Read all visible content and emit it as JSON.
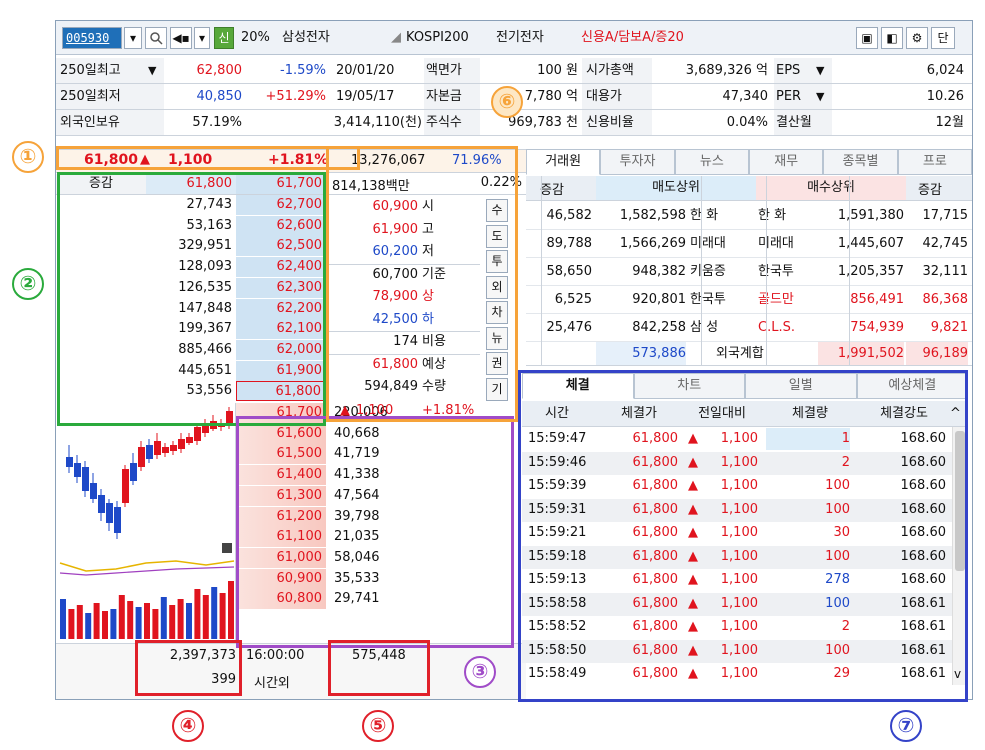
{
  "toolbar": {
    "code": "005930",
    "credit_badge": "신",
    "margin": "20%",
    "stock_name": "삼성전자",
    "index": "KOSPI200",
    "sector": "전기전자",
    "credit_info": "신용A/담보A/증20",
    "menu_label": "단"
  },
  "info": {
    "rows": [
      {
        "l1": "250일최고",
        "v1": "62,800",
        "p1": "-1.59%",
        "d1": "20/01/20",
        "l2": "액면가",
        "v2": "100 원",
        "l3": "시가총액",
        "v3": "3,689,326 억",
        "l4": "EPS",
        "v4": "6,024"
      },
      {
        "l1": "250일최저",
        "v1": "40,850",
        "p1": "+51.29%",
        "d1": "19/05/17",
        "l2": "자본금",
        "v2": "7,780 억",
        "l3": "대용가",
        "v3": "47,340",
        "l4": "PER",
        "v4": "10.26"
      },
      {
        "l1": "외국인보유",
        "v1": "57.19%",
        "p1": "3,414,110(천)",
        "d1": "",
        "l2": "주식수",
        "v2": "969,783 천",
        "l3": "신용비율",
        "v3": "0.04%",
        "l4": "결산월",
        "v4": "12월"
      }
    ]
  },
  "price_bar": {
    "price": "61,800",
    "change": "1,100",
    "rate": "+1.81%",
    "volume": "13,276,067",
    "ratio": "71.96%"
  },
  "orderbook": {
    "header_label": "증감",
    "header_price": "61,800",
    "header_ask": "61,700",
    "trade_value": "814,138백만",
    "trade_rate": "0.22%",
    "asks": [
      {
        "qty": "27,743",
        "price": "62,700"
      },
      {
        "qty": "53,163",
        "price": "62,600"
      },
      {
        "qty": "329,951",
        "price": "62,500"
      },
      {
        "qty": "128,093",
        "price": "62,400"
      },
      {
        "qty": "126,535",
        "price": "62,300"
      },
      {
        "qty": "147,848",
        "price": "62,200"
      },
      {
        "qty": "199,367",
        "price": "62,100"
      },
      {
        "qty": "885,466",
        "price": "62,000"
      },
      {
        "qty": "445,651",
        "price": "61,900"
      },
      {
        "qty": "53,556",
        "price": "61,800"
      }
    ],
    "bids": [
      {
        "price": "61,700",
        "qty": "220,006"
      },
      {
        "price": "61,600",
        "qty": "40,668"
      },
      {
        "price": "61,500",
        "qty": "41,719"
      },
      {
        "price": "61,400",
        "qty": "41,338"
      },
      {
        "price": "61,300",
        "qty": "47,564"
      },
      {
        "price": "61,200",
        "qty": "39,798"
      },
      {
        "price": "61,100",
        "qty": "21,035"
      },
      {
        "price": "61,000",
        "qty": "58,046"
      },
      {
        "price": "60,900",
        "qty": "35,533"
      },
      {
        "price": "60,800",
        "qty": "29,741"
      }
    ],
    "summary": [
      {
        "v": "60,900",
        "l": "시"
      },
      {
        "v": "61,900",
        "l": "고"
      },
      {
        "v": "60,200",
        "l": "저"
      },
      {
        "v": "60,700",
        "l": "기준"
      },
      {
        "v": "78,900",
        "l": "상"
      },
      {
        "v": "42,500",
        "l": "하"
      },
      {
        "v": "174",
        "l": "비용"
      },
      {
        "v": "61,800",
        "l": "예상"
      },
      {
        "v": "594,849",
        "l": "수량"
      }
    ],
    "expected_change": "1,100",
    "expected_rate": "+1.81%",
    "side_buttons": [
      "수",
      "도",
      "투",
      "외",
      "차",
      "뉴",
      "권",
      "기"
    ],
    "total_ask": "2,397,373",
    "total_ask_diff": "399",
    "time": "16:00:00",
    "time_label": "시간외",
    "total_bid": "575,448"
  },
  "broker": {
    "tabs": [
      "거래원",
      "투자자",
      "뉴스",
      "재무",
      "종목별",
      "프로"
    ],
    "head": {
      "c1": "증감",
      "c2": "매도상위",
      "c3": "매수상위",
      "c4": "증감"
    },
    "rows": [
      {
        "sdiff": "46,582",
        "sqty": "1,582,598",
        "sname": "한 화",
        "bname": "한 화",
        "bqty": "1,591,380",
        "bdiff": "17,715"
      },
      {
        "sdiff": "89,788",
        "sqty": "1,566,269",
        "sname": "미래대",
        "bname": "미래대",
        "bqty": "1,445,607",
        "bdiff": "42,745"
      },
      {
        "sdiff": "58,650",
        "sqty": "948,382",
        "sname": "키움증",
        "bname": "한국투",
        "bqty": "1,205,357",
        "bdiff": "32,111"
      },
      {
        "sdiff": "6,525",
        "sqty": "920,801",
        "sname": "한국투",
        "bname": "골드만",
        "bqty": "856,491",
        "bdiff": "86,368"
      },
      {
        "sdiff": "25,476",
        "sqty": "842,258",
        "sname": "삼 성",
        "bname": "C.L.S.",
        "bqty": "754,939",
        "bdiff": "9,821"
      }
    ],
    "foreign": {
      "sell": "573,886",
      "label": "외국계합",
      "buy": "1,991,502",
      "diff": "96,189"
    }
  },
  "trades": {
    "tabs": [
      "체결",
      "차트",
      "일별",
      "예상체결"
    ],
    "head": [
      "시간",
      "체결가",
      "전일대비",
      "체결량",
      "체결강도"
    ],
    "rows": [
      {
        "t": "15:59:47",
        "p": "61,800",
        "c": "1,100",
        "q": "1",
        "s": "168.60"
      },
      {
        "t": "15:59:46",
        "p": "61,800",
        "c": "1,100",
        "q": "2",
        "s": "168.60"
      },
      {
        "t": "15:59:39",
        "p": "61,800",
        "c": "1,100",
        "q": "100",
        "s": "168.60"
      },
      {
        "t": "15:59:31",
        "p": "61,800",
        "c": "1,100",
        "q": "100",
        "s": "168.60"
      },
      {
        "t": "15:59:21",
        "p": "61,800",
        "c": "1,100",
        "q": "30",
        "s": "168.60"
      },
      {
        "t": "15:59:18",
        "p": "61,800",
        "c": "1,100",
        "q": "100",
        "s": "168.60"
      },
      {
        "t": "15:59:13",
        "p": "61,800",
        "c": "1,100",
        "q": "278",
        "s": "168.60"
      },
      {
        "t": "15:58:58",
        "p": "61,800",
        "c": "1,100",
        "q": "100",
        "s": "168.61"
      },
      {
        "t": "15:58:52",
        "p": "61,800",
        "c": "1,100",
        "q": "2",
        "s": "168.61"
      },
      {
        "t": "15:58:50",
        "p": "61,800",
        "c": "1,100",
        "q": "100",
        "s": "168.61"
      },
      {
        "t": "15:58:49",
        "p": "61,800",
        "c": "1,100",
        "q": "29",
        "s": "168.61"
      }
    ],
    "qty_colors": [
      "#e0141e",
      "#e0141e",
      "#e0141e",
      "#e0141e",
      "#e0141e",
      "#e0141e",
      "#1e49c8",
      "#1e49c8",
      "#e0141e",
      "#e0141e",
      "#e0141e"
    ]
  },
  "annotations": [
    "①",
    "②",
    "③",
    "④",
    "⑤",
    "⑥",
    "⑦"
  ],
  "colors": {
    "orange": "#f6a33a",
    "green": "#2aaa3c",
    "purple": "#a04cc8",
    "red": "#e0202a",
    "blue": "#3443c8",
    "up": "#e0141e",
    "down": "#1e49c8"
  }
}
